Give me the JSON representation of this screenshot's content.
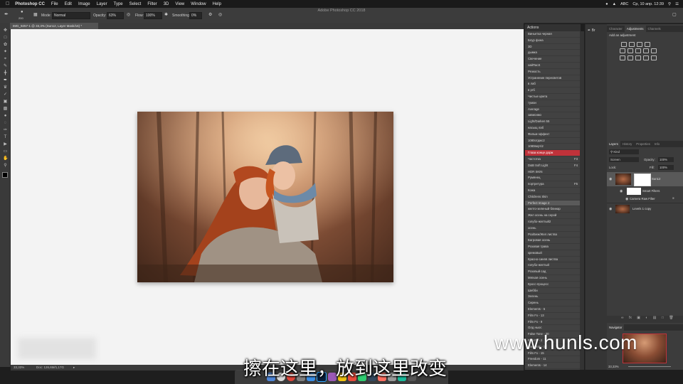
{
  "menubar": {
    "app": "Photoshop CC",
    "items": [
      "File",
      "Edit",
      "Image",
      "Layer",
      "Type",
      "Select",
      "Filter",
      "3D",
      "View",
      "Window",
      "Help"
    ],
    "status": [
      "ABC",
      "Ср, 10 апр.  12:39"
    ]
  },
  "window_title": "Adobe Photoshop CC 2018",
  "options": {
    "brush_size": "200",
    "mode_label": "Mode:",
    "mode_value": "Normal",
    "opacity_label": "Opacity:",
    "opacity_value": "63%",
    "flow_label": "Flow:",
    "flow_value": "100%",
    "smoothing_label": "Smoothing:",
    "smoothing_value": "0%"
  },
  "document_tab": "IMG_9257-1 @ 33,3% (Sun12, Layer Mask/16) *",
  "status_bar": {
    "zoom": "33,33%",
    "doc": "Doc: 126,6M/1,17G"
  },
  "actions": {
    "title": "Actions",
    "items": [
      {
        "label": "Виньетка черная"
      },
      {
        "label": "Блур фона"
      },
      {
        "label": "3D"
      },
      {
        "label": "дымка"
      },
      {
        "label": "Свечение"
      },
      {
        "label": "хайПасS"
      },
      {
        "label": "Резкость"
      },
      {
        "label": "Устранение пересветов"
      },
      {
        "label": "в лаб"
      },
      {
        "label": "в ргб"
      },
      {
        "label": "Чистые цвета"
      },
      {
        "label": "туман"
      },
      {
        "label": "Average"
      },
      {
        "label": "зависимо"
      },
      {
        "label": "Light/Darken 55"
      },
      {
        "label": "насыщ лаб"
      },
      {
        "label": "Фильм-эффект"
      },
      {
        "label": "1080отджс2"
      },
      {
        "label": "1080вертi2"
      },
      {
        "label": "Глаза конце дорж",
        "state": "red"
      },
      {
        "label": "Частотка",
        "shortcut": "F3"
      },
      {
        "label": "D&B Soft Light",
        "shortcut": "F4"
      },
      {
        "label": "HDR SKIN"
      },
      {
        "label": "Румянец"
      },
      {
        "label": "портретура",
        "shortcut": "F5"
      },
      {
        "label": "Кожа"
      },
      {
        "label": "Childrens Skin"
      },
      {
        "label": "Perfect Image 2",
        "state": "gray"
      },
      {
        "label": "желто-зеленый блинар"
      },
      {
        "label": "Жел осень на серой"
      },
      {
        "label": "голубо-желтый2"
      },
      {
        "label": "осень"
      },
      {
        "label": "Роз/Беж/Жел листва"
      },
      {
        "label": "Багровая осень"
      },
      {
        "label": "Розовая трава"
      },
      {
        "label": "кремовый"
      },
      {
        "label": "Красно-синяя листва"
      },
      {
        "label": "голубо-желтый"
      },
      {
        "label": "Розовый сад"
      },
      {
        "label": "Мягкая осень"
      },
      {
        "label": "Кросс-процесс"
      },
      {
        "label": "Шебби"
      },
      {
        "label": "Зелень"
      },
      {
        "label": "Сирень"
      },
      {
        "label": "Elements - 5"
      },
      {
        "label": "Film Fx - 13"
      },
      {
        "label": "Film Fx - 9"
      },
      {
        "label": "Олд ныос"
      },
      {
        "label": "False Tone - 20"
      },
      {
        "label": "Film Fx - 2"
      },
      {
        "label": "Elements - 13"
      },
      {
        "label": "Film Fx - 15"
      },
      {
        "label": "Freedom - 11"
      },
      {
        "label": "Elements - 14"
      },
      {
        "label": "Film Fx - 16"
      },
      {
        "label": "False Tone - 5"
      },
      {
        "label": "False Tone - 3"
      },
      {
        "label": "Film Fx - 18"
      },
      {
        "label": "Polaroid - 12"
      }
    ]
  },
  "panels": {
    "top_tabs": [
      "Character",
      "Adjustments",
      "Channels"
    ],
    "add_adjustment": "Add an adjustment",
    "layer_tabs": [
      "Layers",
      "History",
      "Properties",
      "Info"
    ],
    "kind": "Kind",
    "blend_mode": "Screen",
    "opacity_label": "Opacity:",
    "opacity_value": "100%",
    "lock_label": "Lock:",
    "fill_label": "Fill:",
    "fill_value": "100%",
    "layers": [
      {
        "name": "Sun12"
      },
      {
        "name": "Smart Filters"
      },
      {
        "name": "Camera Raw Filter"
      },
      {
        "name": "Levels 1 copy"
      }
    ],
    "navigator_title": "Navigator",
    "navigator_zoom": "33,33%"
  },
  "overlays": {
    "watermark": "www.hunls.com",
    "subtitle": "擦在这里，放到这里改变"
  },
  "colors": {
    "accent_red": "#c0323a",
    "canvas": "#f3f3f3",
    "panel": "#424242"
  }
}
